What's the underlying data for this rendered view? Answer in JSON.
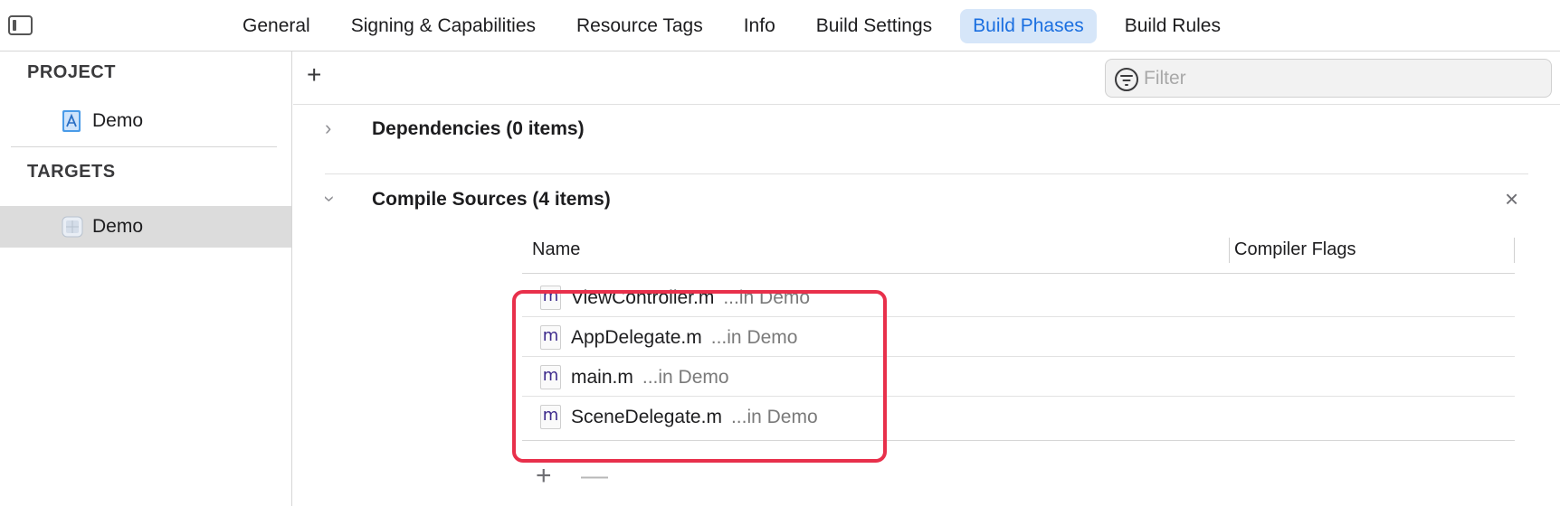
{
  "tabs": [
    {
      "label": "General"
    },
    {
      "label": "Signing & Capabilities"
    },
    {
      "label": "Resource Tags"
    },
    {
      "label": "Info"
    },
    {
      "label": "Build Settings"
    },
    {
      "label": "Build Phases",
      "active": true
    },
    {
      "label": "Build Rules"
    }
  ],
  "sidebar": {
    "project_header": "PROJECT",
    "project_item": "Demo",
    "targets_header": "TARGETS",
    "target_item": "Demo",
    "selected_background": "#dcdcdc"
  },
  "toolbar": {
    "add_symbol": "+",
    "filter_placeholder": "Filter"
  },
  "phases": {
    "dependencies": {
      "title": "Dependencies (0 items)",
      "expanded": false
    },
    "compile_sources": {
      "title": "Compile Sources (4 items)",
      "expanded": true,
      "close_symbol": "×"
    }
  },
  "table": {
    "col_name": "Name",
    "col_flags": "Compiler Flags",
    "rows": [
      {
        "icon": "m",
        "name": "ViewController.m",
        "path": "...in Demo"
      },
      {
        "icon": "m",
        "name": "AppDelegate.m",
        "path": "...in Demo"
      },
      {
        "icon": "m",
        "name": "main.m",
        "path": "...in Demo"
      },
      {
        "icon": "m",
        "name": "SceneDelegate.m",
        "path": "...in Demo"
      }
    ],
    "add_symbol": "+",
    "remove_symbol": "—"
  },
  "colors": {
    "accent": "#1b6fe0",
    "active_tab_bg": "#d6e6f9",
    "highlight": "#e8304b"
  }
}
